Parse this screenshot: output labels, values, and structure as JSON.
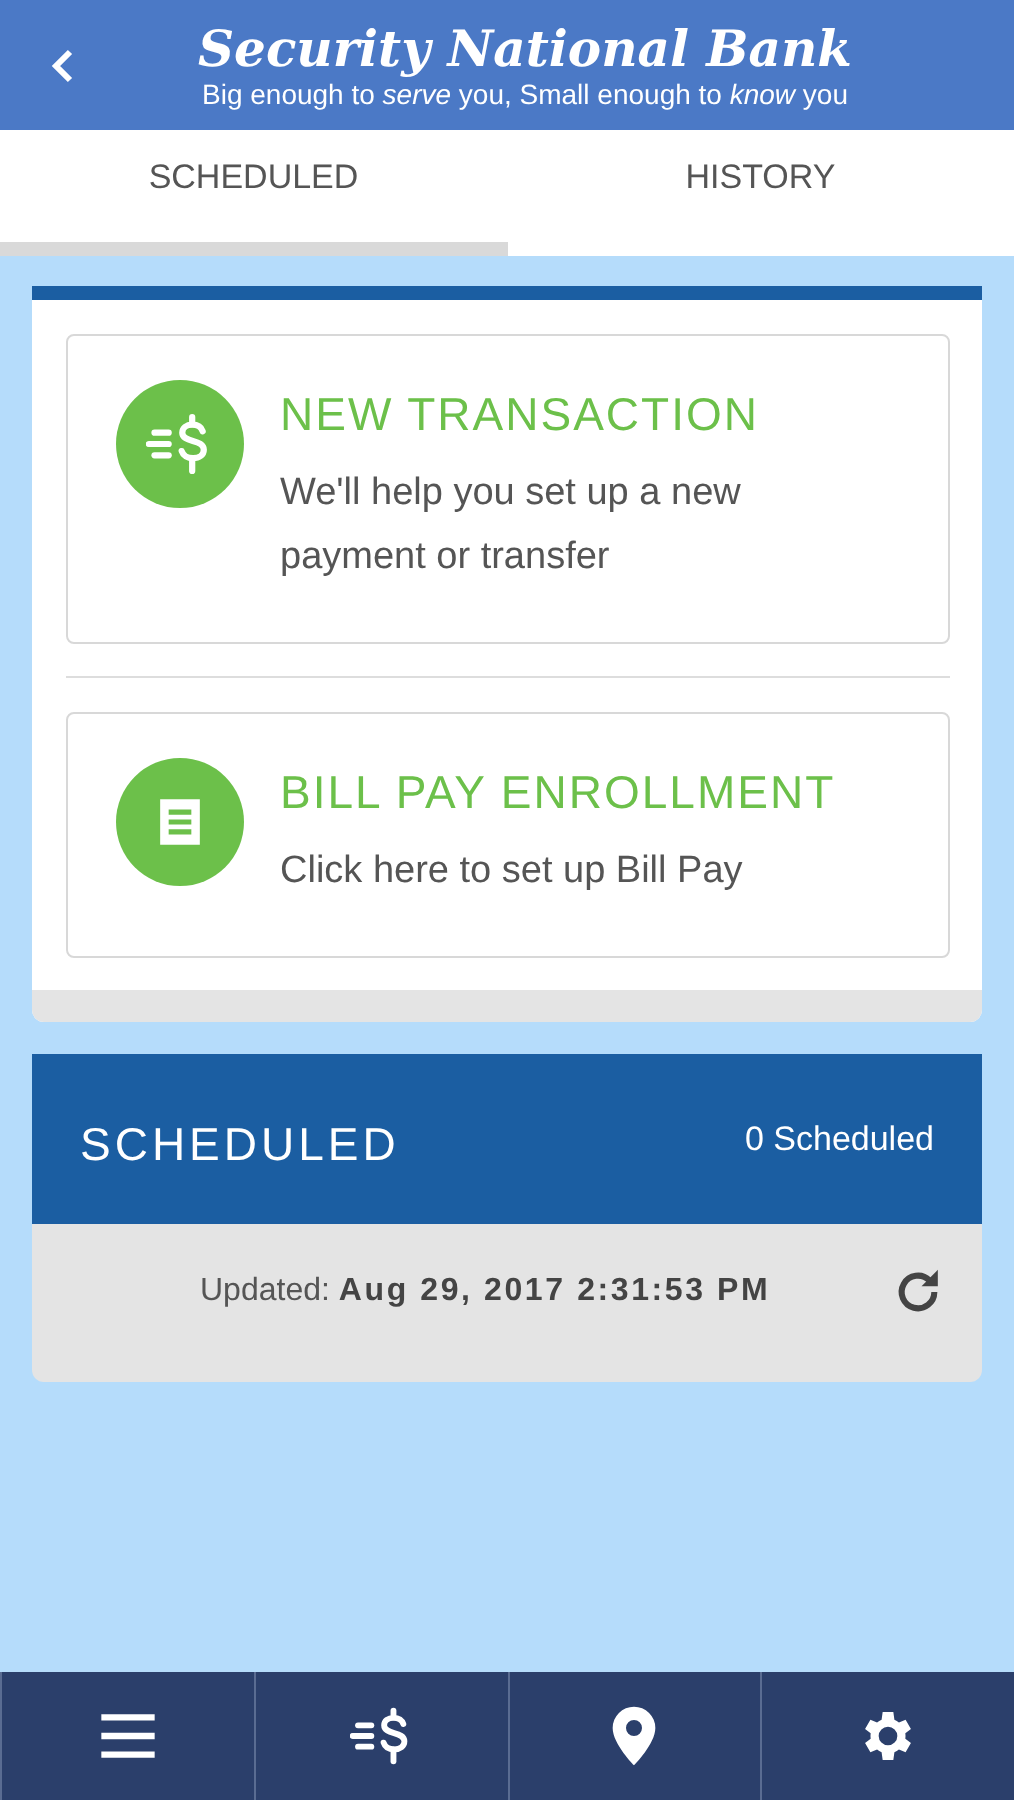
{
  "header": {
    "title": "Security National Bank",
    "tagline": "Big enough to *serve* you, Small enough to *know* you"
  },
  "tabs": [
    {
      "label": "SCHEDULED",
      "selected": true
    },
    {
      "label": "HISTORY",
      "selected": false
    }
  ],
  "actions": [
    {
      "kind": "transaction",
      "title": "NEW TRANSACTION",
      "description": "We'll help you set up a new payment or transfer"
    },
    {
      "kind": "billpay",
      "title": "BILL PAY ENROLLMENT",
      "description": "Click here to set up Bill Pay"
    }
  ],
  "scheduled": {
    "title": "SCHEDULED",
    "count": "0 Scheduled",
    "updated_label": "Updated:",
    "updated_time": "Aug 29, 2017 2:31:53 PM"
  },
  "bottom_nav": [
    {
      "kind": "menu"
    },
    {
      "kind": "transaction"
    },
    {
      "kind": "location"
    },
    {
      "kind": "settings"
    }
  ]
}
